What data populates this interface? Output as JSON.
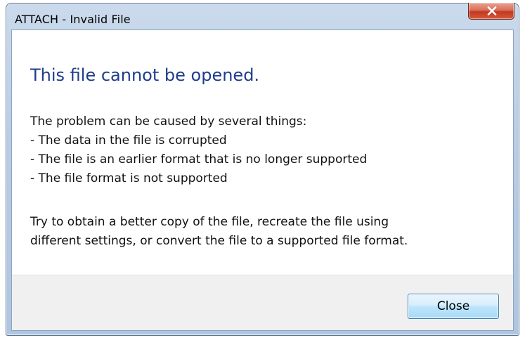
{
  "window": {
    "title": "ATTACH - Invalid File"
  },
  "icons": {
    "close": "close-icon"
  },
  "dialog": {
    "heading": "This file cannot be opened.",
    "intro": "The problem can be caused by several things:",
    "reasons": [
      "- The data in the file is corrupted",
      "- The file is an earlier format that is no longer supported",
      "- The file format is not supported"
    ],
    "advice_line1": "Try to obtain a better copy of the file, recreate the file using",
    "advice_line2": "different settings, or convert the file to a supported file format."
  },
  "buttons": {
    "close_label": "Close"
  },
  "colors": {
    "heading": "#1f3d8c",
    "close_button_accent": "#c23a1f",
    "default_button_border": "#3c7fb1"
  }
}
